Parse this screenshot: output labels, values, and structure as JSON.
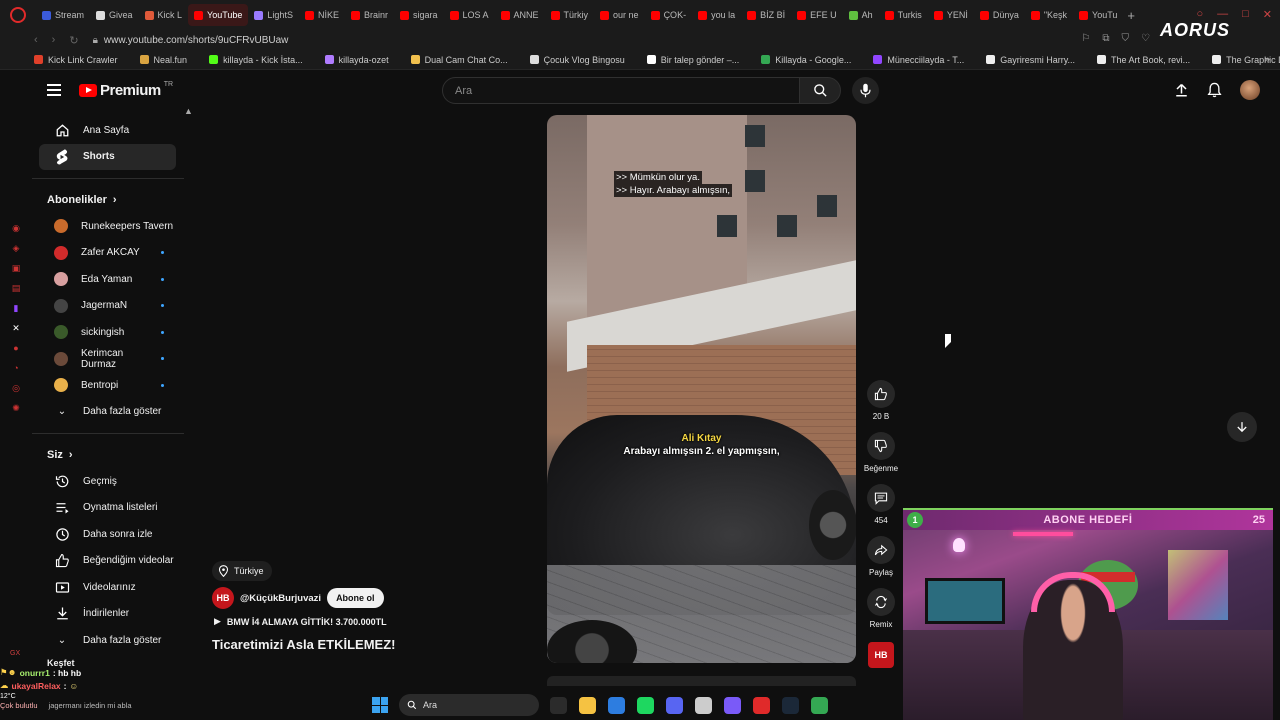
{
  "browser": {
    "tabs": [
      {
        "label": "Stream",
        "color": "#3b5bdb"
      },
      {
        "label": "Givea",
        "color": "#dddddd"
      },
      {
        "label": "Kick L",
        "color": "#e05a3a"
      },
      {
        "label": "YouTube",
        "color": "#ff0000",
        "active": true
      },
      {
        "label": "LightS",
        "color": "#9a7bff"
      },
      {
        "label": "NİKE",
        "color": "#ff0000"
      },
      {
        "label": "Brainr",
        "color": "#ff0000"
      },
      {
        "label": "sigara",
        "color": "#ff0000"
      },
      {
        "label": "LOS A",
        "color": "#ff0000"
      },
      {
        "label": "ANNE",
        "color": "#ff0000"
      },
      {
        "label": "Türkiy",
        "color": "#ff0000"
      },
      {
        "label": "our ne",
        "color": "#ff0000"
      },
      {
        "label": "ÇOK-",
        "color": "#ff0000"
      },
      {
        "label": "you la",
        "color": "#ff0000"
      },
      {
        "label": "BİZ Bİ",
        "color": "#ff0000"
      },
      {
        "label": "EFE U",
        "color": "#ff0000"
      },
      {
        "label": "Ah",
        "color": "#5fbf3f"
      },
      {
        "label": "Turkis",
        "color": "#ff0000"
      },
      {
        "label": "YENİ",
        "color": "#ff0000"
      },
      {
        "label": "Dünya",
        "color": "#ff0000"
      },
      {
        "label": "\"Keşk",
        "color": "#ff0000"
      },
      {
        "label": "YouTu",
        "color": "#ff0000"
      }
    ],
    "new_tab": "+",
    "url": "www.youtube.com/shorts/9uCFRvUBUaw",
    "brand": "AORUS",
    "bookmarks": [
      {
        "label": "Kick Link Crawler",
        "color": "#e0402a"
      },
      {
        "label": "Neal.fun",
        "color": "#d9a441"
      },
      {
        "label": "killayda - Kick İsta...",
        "color": "#53fc18"
      },
      {
        "label": "killayda-ozet",
        "color": "#b07cff"
      },
      {
        "label": "Dual Cam Chat Co...",
        "color": "#f2c14e"
      },
      {
        "label": "Çocuk Vlog Bingosu",
        "color": "#dddddd"
      },
      {
        "label": "Bir talep gönder –...",
        "color": "#ffffff"
      },
      {
        "label": "Killayda - Google...",
        "color": "#34a853"
      },
      {
        "label": "Münecciilayda - T...",
        "color": "#9146ff"
      },
      {
        "label": "Gayriresmi Harry...",
        "color": "#eeeeee"
      },
      {
        "label": "The Art Book, revi...",
        "color": "#eeeeee"
      },
      {
        "label": "The Graphic Desig...",
        "color": "#eeeeee"
      }
    ]
  },
  "header": {
    "logo_text": "Premium",
    "logo_suffix": "TR",
    "search_placeholder": "Ara"
  },
  "sidebar": {
    "main": [
      {
        "label": "Ana Sayfa",
        "icon": "home-icon"
      },
      {
        "label": "Shorts",
        "icon": "shorts-icon",
        "active": true
      }
    ],
    "subscriptions_title": "Abonelikler",
    "subscriptions": [
      {
        "label": "Runekeepers Tavern",
        "color": "#c96b2c",
        "dot": false
      },
      {
        "label": "Zafer AKCAY",
        "color": "#d22b2b",
        "dot": true
      },
      {
        "label": "Eda Yaman",
        "color": "#d8a0a0",
        "dot": true
      },
      {
        "label": "JagermaN",
        "color": "#444444",
        "dot": true
      },
      {
        "label": "sickingish",
        "color": "#3a5a2a",
        "dot": true
      },
      {
        "label": "Kerimcan Durmaz",
        "color": "#6b4a3a",
        "dot": true
      },
      {
        "label": "Bentropi",
        "color": "#e8b04a",
        "dot": true
      }
    ],
    "show_more": "Daha fazla göster",
    "you_title": "Siz",
    "you_items": [
      {
        "label": "Geçmiş",
        "icon": "history-icon"
      },
      {
        "label": "Oynatma listeleri",
        "icon": "playlist-icon"
      },
      {
        "label": "Daha sonra izle",
        "icon": "clock-icon"
      },
      {
        "label": "Beğendiğim videolar",
        "icon": "like-icon"
      },
      {
        "label": "Videolarınız",
        "icon": "video-icon"
      },
      {
        "label": "İndirilenler",
        "icon": "download-icon"
      }
    ],
    "you_show_more": "Daha fazla göster",
    "explore_title": "Keşfet"
  },
  "video": {
    "caption_top_1": ">> Mümkün olur ya.",
    "caption_top_2": ">> Hayır. Arabayı almışsın,",
    "caption_name": "Ali Kıtay",
    "caption_line": "Arabayı almışsın 2. el yapmışsın,",
    "location": "Türkiye",
    "channel_initials": "HB",
    "channel": "@KüçükBurjuvazi",
    "subscribe": "Abone ol",
    "track": "BMW İ4 ALMAYA GİTTİK! 3.700.000TL",
    "title": "Ticaretimizi Asla ETKİLEMEZ!"
  },
  "actions": {
    "like_count": "20 B",
    "dislike_label": "Beğenme",
    "comment_count": "454",
    "share_label": "Paylaş",
    "remix_label": "Remix"
  },
  "overlay": {
    "goal_current": "1",
    "goal_title": "ABONE HEDEFİ",
    "goal_target": "25",
    "gx_label": "GX",
    "chat": [
      {
        "user": "onurrr1",
        "message": ": hb hb"
      },
      {
        "user": "ukayalRelax",
        "message": ":"
      }
    ],
    "weather_temp": "12°C",
    "weather_desc": "Çok bulutlu",
    "ticker": "jagermanı izledin mi abla"
  },
  "taskbar": {
    "search_label": "Ara",
    "apps": [
      "#2b2b2b",
      "#f5c242",
      "#2d7de0",
      "#1ed760",
      "#5865f2",
      "#cccccc",
      "#7a5af8",
      "#e02a2a",
      "#1b2838",
      "#34a853"
    ]
  }
}
